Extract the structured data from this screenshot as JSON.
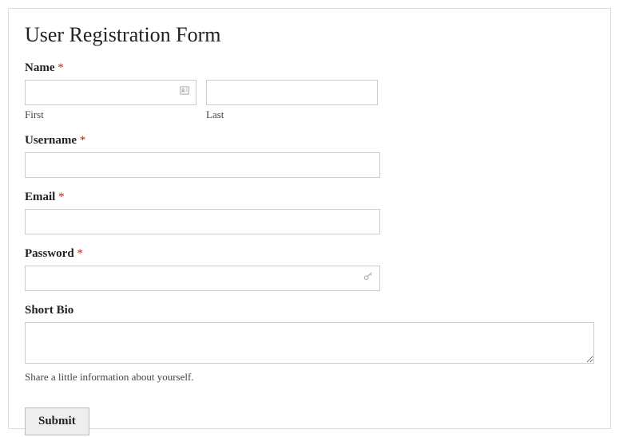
{
  "form": {
    "title": "User Registration Form",
    "required_marker": "*",
    "name": {
      "label": "Name",
      "first_sublabel": "First",
      "last_sublabel": "Last",
      "first_value": "",
      "last_value": ""
    },
    "username": {
      "label": "Username",
      "value": ""
    },
    "email": {
      "label": "Email",
      "value": ""
    },
    "password": {
      "label": "Password",
      "value": ""
    },
    "bio": {
      "label": "Short Bio",
      "value": "",
      "helper": "Share a little information about yourself."
    },
    "submit_label": "Submit"
  }
}
